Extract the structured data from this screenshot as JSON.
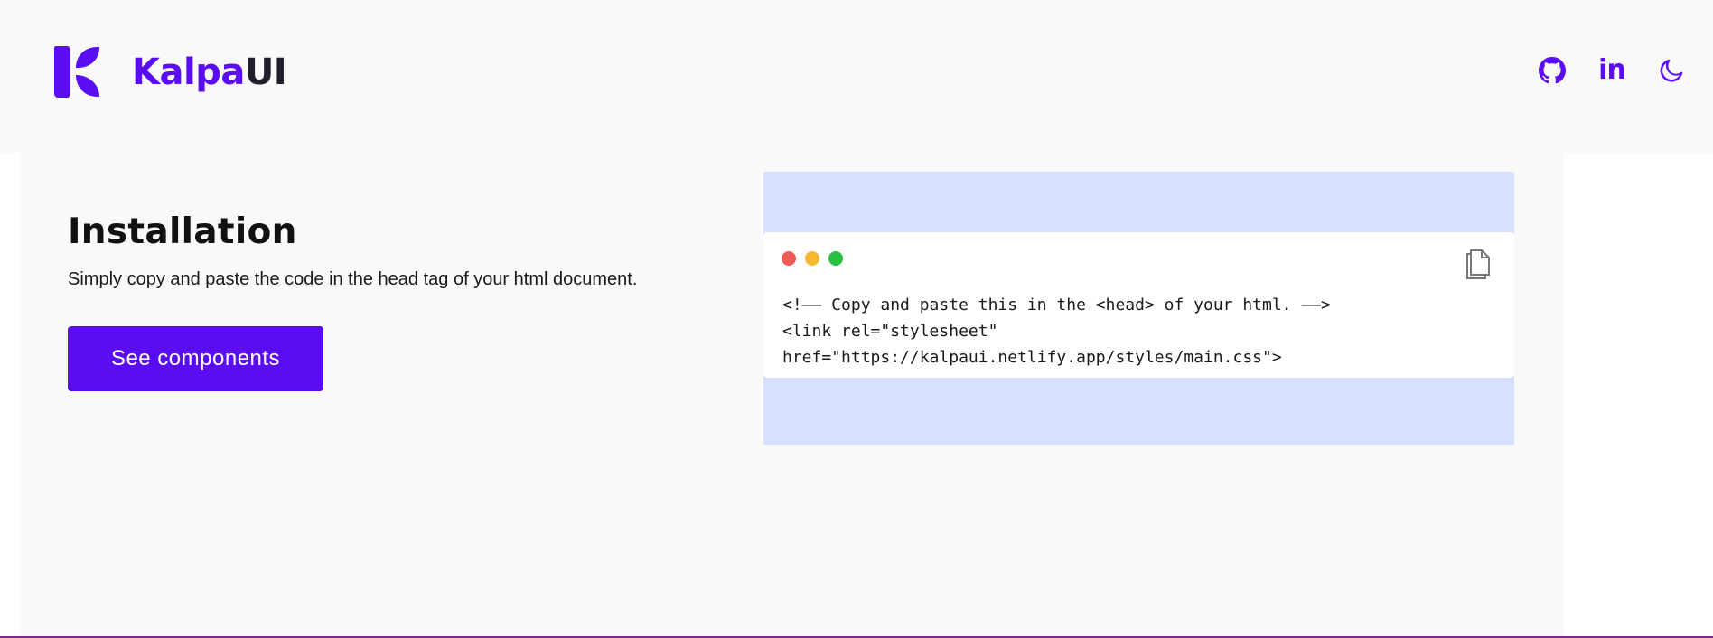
{
  "header": {
    "brand_accent": "Kalpa",
    "brand_dark": "UI",
    "icons": [
      "github-icon",
      "linkedin-icon",
      "moon-icon"
    ],
    "linkedin_label": "in"
  },
  "installation": {
    "title": "Installation",
    "subtitle": "Simply copy and paste the code in the head tag of your html document.",
    "cta_label": "See components"
  },
  "code_window": {
    "lines": [
      "<!—— Copy and paste this in the <head> of your html. ——>",
      "<link rel=\"stylesheet\"",
      "href=\"https://kalpaui.netlify.app/styles/main.css\">"
    ],
    "copy_icon": "copy-icon"
  },
  "colors": {
    "accent": "#5a0df2",
    "code_background": "#d8e0ff",
    "dot_red": "#f25b56",
    "dot_yellow": "#f5b82e",
    "dot_green": "#29c140"
  }
}
